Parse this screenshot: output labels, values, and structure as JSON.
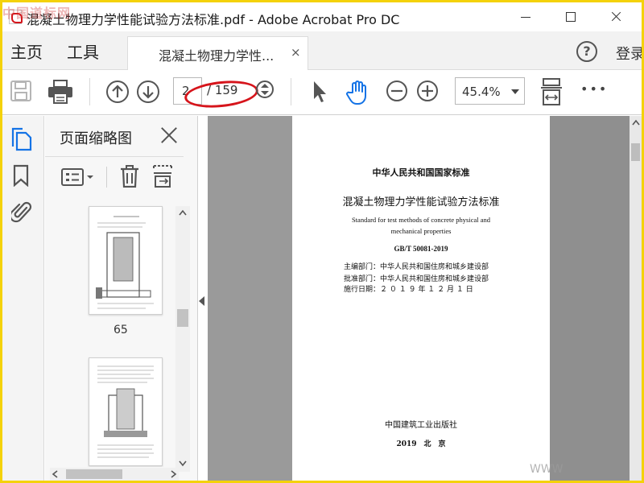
{
  "window": {
    "title": "混凝土物理力学性能试验方法标准.pdf - Adobe Acrobat Pro DC",
    "watermark": "中国道标网"
  },
  "menu": {
    "home": "主页",
    "tools": "工具",
    "doc_tab": "混凝土物理力学性...",
    "doc_tab_close": "×",
    "help": "?",
    "signin": "登录"
  },
  "toolbar": {
    "page_current": "2",
    "page_total": "/ 159",
    "zoom": "45.4%",
    "more": "•••"
  },
  "panel": {
    "title": "页面缩略图",
    "thumbnail_label": "65"
  },
  "document": {
    "line1": "中华人民共和国国家标准",
    "line2": "混凝土物理力学性能试验方法标准",
    "line3": "Standard for test methods of concrete physical and",
    "line4": "mechanical properties",
    "code": "GB/T 50081-2019",
    "info1": "主编部门：中华人民共和国住房和城乡建设部",
    "info2": "批准部门：中华人民共和国住房和城乡建设部",
    "info3": "施行日期：２ ０ １ ９ 年 １ ２ 月 １ 日",
    "publisher": "中国建筑工业出版社",
    "year_city": "2019　北　京"
  },
  "corner_watermark": "WWW",
  "colors": {
    "accent": "#1473e6",
    "highlight": "#d6141b",
    "border_frame": "#f4d20a"
  }
}
